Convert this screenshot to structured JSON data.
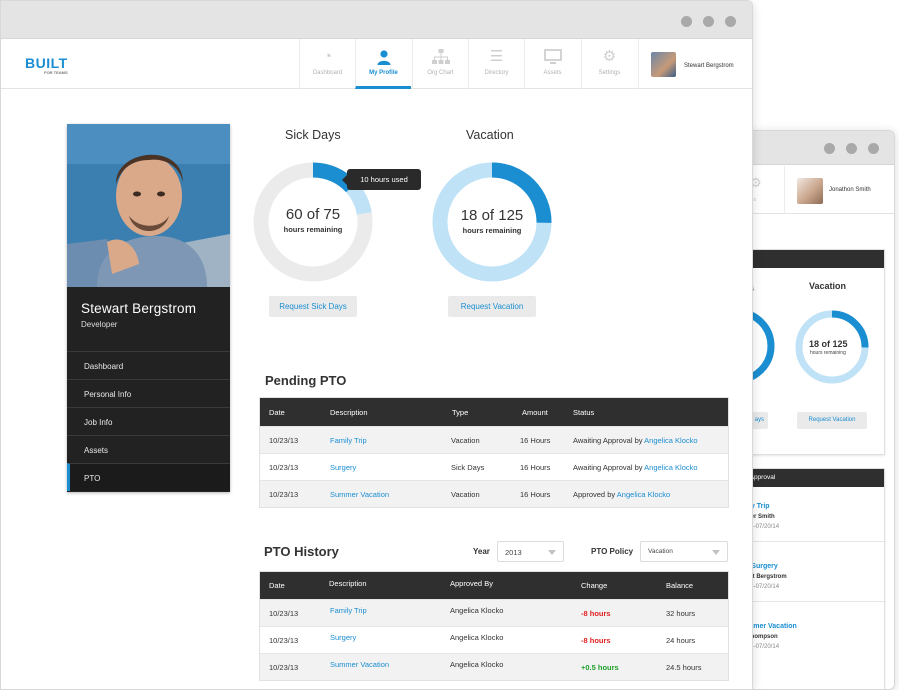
{
  "colors": {
    "accent": "#1a8ed1",
    "dark": "#2f2f2f",
    "donut_light": "#bfe2f7",
    "donut_track": "#ebebeb",
    "negative": "#e02020",
    "positive": "#1fa02a"
  },
  "app": {
    "logo_main": "BUILT",
    "logo_sub": "FOR TEAMS"
  },
  "nav": {
    "items": [
      {
        "label": "Dashboard",
        "icon": "pie-chart-icon"
      },
      {
        "label": "My Profile",
        "icon": "person-icon",
        "active": true
      },
      {
        "label": "Org Chart",
        "icon": "org-chart-icon"
      },
      {
        "label": "Directory",
        "icon": "list-icon"
      },
      {
        "label": "Assets",
        "icon": "monitor-icon"
      },
      {
        "label": "Settings",
        "icon": "gear-icon"
      }
    ],
    "user_name": "Stewart Bergstrom"
  },
  "profile": {
    "name": "Stewart Bergstrom",
    "role": "Developer",
    "menu": [
      "Dashboard",
      "Personal Info",
      "Job Info",
      "Assets",
      "PTO"
    ],
    "active_menu": "PTO"
  },
  "sick": {
    "title": "Sick Days",
    "value": "60 of 75",
    "sub": "hours remaining",
    "used": 10,
    "total": 75,
    "remaining": 60,
    "tooltip": "10 hours used",
    "button": "Request Sick Days"
  },
  "vacation": {
    "title": "Vacation",
    "value": "18 of 125",
    "sub": "hours remaining",
    "remaining": 18,
    "total": 125,
    "button": "Request Vacation"
  },
  "pending": {
    "title": "Pending PTO",
    "columns": [
      "Date",
      "Description",
      "Type",
      "Amount",
      "Status"
    ],
    "rows": [
      {
        "date": "10/23/13",
        "description": "Family Trip",
        "type": "Vacation",
        "amount": "16 Hours",
        "status": "Awaiting Approval by",
        "approver": "Angelica Klocko"
      },
      {
        "date": "10/23/13",
        "description": "Surgery",
        "type": "Sick Days",
        "amount": "16 Hours",
        "status": "Awaiting Approval by",
        "approver": "Angelica Klocko"
      },
      {
        "date": "10/23/13",
        "description": "Summer Vacation",
        "type": "Vacation",
        "amount": "16 Hours",
        "status": "Approved by",
        "approver": "Angelica Klocko"
      }
    ]
  },
  "history": {
    "title": "PTO History",
    "year_label": "Year",
    "year_value": "2013",
    "policy_label": "PTO Policy",
    "policy_value": "Vacation",
    "columns": [
      "Date",
      "Description",
      "Approved By",
      "Change",
      "Balance"
    ],
    "rows": [
      {
        "date": "10/23/13",
        "description": "Family Trip",
        "approved_by": "Angelica Klocko",
        "change": "-8 hours",
        "balance": "32 hours"
      },
      {
        "date": "10/23/13",
        "description": "Surgery",
        "approved_by": "Angelica Klocko",
        "change": "-8 hours",
        "balance": "24 hours"
      },
      {
        "date": "10/23/13",
        "description": "Summer Vacation",
        "approved_by": "Angelica Klocko",
        "change": "+0.5 hours",
        "balance": "24.5 hours"
      }
    ]
  },
  "back_window": {
    "nav_settings_label": "ttings",
    "user_name": "Jonathon Smith",
    "sick_title_fragment": "s",
    "sick_value_fragment": "e",
    "sick_button_fragment": "ays",
    "vacation_title": "Vacation",
    "vacation_value": "18 of 125",
    "vacation_sub": "hours remaining",
    "vacation_button": "Request Vacation",
    "approval_title": "r Approval",
    "approvals": [
      {
        "title": "ily Trip",
        "name": "ifer Smith",
        "dates": "14-07/20/14"
      },
      {
        "title": "- Surgery",
        "name": "art Bergstrom",
        "dates": "14-07/20/14"
      },
      {
        "title": "mmer Vacation",
        "name": "Thompson",
        "dates": "14-07/20/14"
      }
    ]
  }
}
